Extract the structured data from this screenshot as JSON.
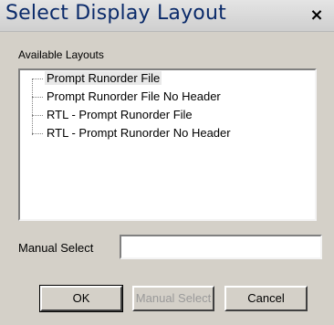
{
  "window": {
    "title": "Select Display Layout",
    "close_label": "×"
  },
  "layouts_group": {
    "label": "Available Layouts",
    "items": [
      {
        "label": "Prompt Runorder File",
        "selected": true
      },
      {
        "label": "Prompt Runorder File No Header",
        "selected": false
      },
      {
        "label": "RTL - Prompt Runorder File",
        "selected": false
      },
      {
        "label": "RTL - Prompt Runorder No Header",
        "selected": false
      }
    ]
  },
  "manual_select": {
    "label": "Manual Select",
    "value": ""
  },
  "buttons": {
    "ok": "OK",
    "manual_select": "Manual Select",
    "cancel": "Cancel"
  }
}
